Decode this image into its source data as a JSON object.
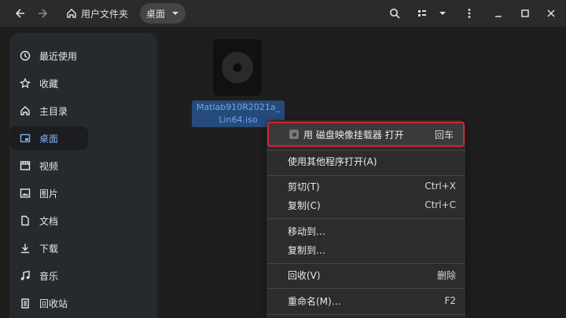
{
  "header": {
    "home_label": "用户文件夹",
    "current_folder": "桌面"
  },
  "sidebar": {
    "items": [
      {
        "label": "最近使用",
        "icon": "clock-icon"
      },
      {
        "label": "收藏",
        "icon": "star-icon"
      },
      {
        "label": "主目录",
        "icon": "home-icon"
      },
      {
        "label": "桌面",
        "icon": "desktop-icon"
      },
      {
        "label": "视频",
        "icon": "video-icon"
      },
      {
        "label": "图片",
        "icon": "image-icon"
      },
      {
        "label": "文档",
        "icon": "document-icon"
      },
      {
        "label": "下载",
        "icon": "download-icon"
      },
      {
        "label": "音乐",
        "icon": "music-icon"
      },
      {
        "label": "回收站",
        "icon": "trash-icon"
      }
    ]
  },
  "file": {
    "name_line1": "Matlab910R2021a_",
    "name_line2": "Lin64.iso"
  },
  "context_menu": {
    "items": [
      {
        "label": "用 磁盘映像挂载器 打开",
        "accel": "回车"
      },
      {
        "label": "使用其他程序打开(A)",
        "accel": ""
      },
      {
        "label": "剪切(T)",
        "accel": "Ctrl+X"
      },
      {
        "label": "复制(C)",
        "accel": "Ctrl+C"
      },
      {
        "label": "移动到…",
        "accel": ""
      },
      {
        "label": "复制到…",
        "accel": ""
      },
      {
        "label": "回收(V)",
        "accel": "删除"
      },
      {
        "label": "重命名(M)…",
        "accel": "F2"
      }
    ]
  },
  "colors": {
    "accent": "#7eb0f0",
    "highlight_border": "#d0262b",
    "selection_bg": "#264a7a"
  }
}
